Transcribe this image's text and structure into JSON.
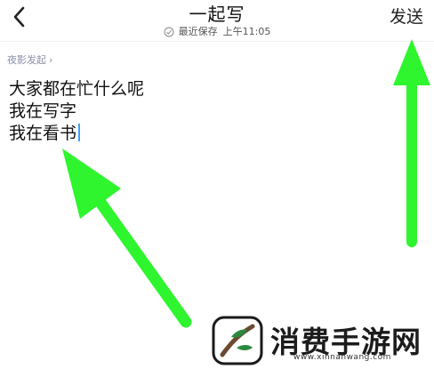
{
  "header": {
    "title": "一起写",
    "save_status": "最近保存",
    "save_time": "上午11:05",
    "send_label": "发送"
  },
  "breadcrumb": {
    "label": "夜影发起",
    "chevron": "›"
  },
  "editor": {
    "lines": [
      "大家都在忙什么呢",
      "我在写字",
      "我在看书"
    ]
  },
  "watermark": {
    "brand_name": "消费手游网",
    "url": "www.xinnanwang.com"
  },
  "colors": {
    "arrow": "#2ef52e",
    "arrow_stroke": "#1fbf1f",
    "caret": "#3aa0ff",
    "crumb": "#8c8fa8"
  },
  "icons": {
    "back": "chevron-left-icon",
    "saved": "check-circle-icon",
    "crumb": "chevron-right-icon"
  }
}
